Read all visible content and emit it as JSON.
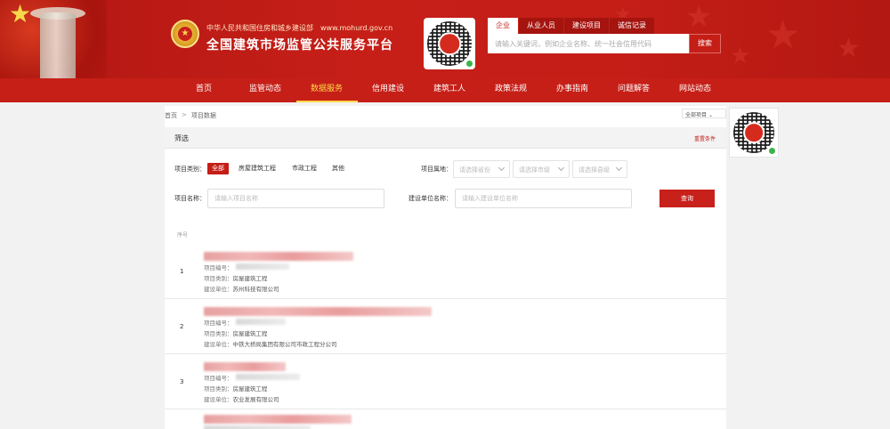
{
  "header": {
    "ministry": "中华人民共和国住房和城乡建设部",
    "url": "www.mohurd.gov.cn",
    "site_title": "全国建筑市场监管公共服务平台",
    "search_tabs": [
      "企业",
      "从业人员",
      "建设项目",
      "诚信记录"
    ],
    "active_tab": "企业",
    "search_placeholder": "请输入关键词，例如企业名称、统一社会信用代码",
    "search_button": "搜索"
  },
  "nav": {
    "items": [
      "首页",
      "监管动态",
      "数据服务",
      "信用建设",
      "建筑工人",
      "政策法规",
      "办事指南",
      "问题解答",
      "网站动态"
    ],
    "active": "数据服务"
  },
  "breadcrumb": {
    "home": "首页",
    "current": "项目数据"
  },
  "side_select": "全部项目",
  "filter": {
    "title": "筛选",
    "reset": "重置条件",
    "type_label": "项目类别：",
    "type_options": [
      "全部",
      "房屋建筑工程",
      "市政工程",
      "其他"
    ],
    "active_type": "全部",
    "region_label": "项目属地：",
    "province_placeholder": "请选择省份",
    "city_placeholder": "请选择市级",
    "county_placeholder": "请选择县级",
    "name_label": "项目名称：",
    "name_placeholder": "请输入项目名称",
    "builder_label": "建设单位名称：",
    "builder_placeholder": "请输入建设单位名称",
    "query_button": "查询"
  },
  "list": {
    "index_header": "序号",
    "code_label": "项目编号：",
    "category_label": "项目类别：",
    "builder_label": "建设单位：",
    "rows": [
      {
        "index": "1",
        "category": "房屋建筑工程",
        "builder": "苏州科技有限公司"
      },
      {
        "index": "2",
        "category": "房屋建筑工程",
        "builder": "中铁大桥局集团有限公司市政工程分公司"
      },
      {
        "index": "3",
        "category": "房屋建筑工程",
        "builder": "农业发展有限公司"
      }
    ]
  }
}
